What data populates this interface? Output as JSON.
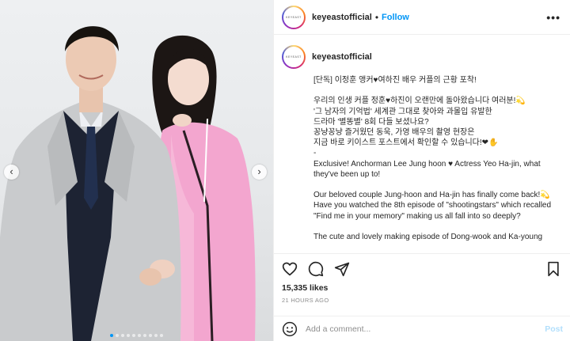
{
  "account": {
    "username": "keyeastofficial",
    "separator": "•",
    "follow_label": "Follow",
    "more_label": "•••",
    "logo_text": "KEYEAST"
  },
  "caption": {
    "lines": [
      "[단독] 이정훈 앵커♥여하진 배우 커플의 근황 포착!",
      "",
      "우리의 인생 커플 정훈♥하진이 오랜만에 돌아왔습니다 여러분!💫",
      "'그 남자의 기억법' 세계관 그대로 찾아와 과몰입 유발한",
      "드라마 '별똥별' 8회 다들 보셨나요?",
      "꽁냥꽁냥 즐거웠던 동욱, 가영 배우의 촬영 현장은",
      "지금 바로 키이스트 포스트에서 확인할 수 있습니다!❤✋",
      "-",
      "Exclusive! Anchorman Lee Jung hoon ♥ Actress Yeo Ha-jin, what",
      "they've been up to!",
      "",
      "Our beloved couple Jung-hoon and Ha-jin has finally come back!💫",
      "Have you watched the 8th episode of \"shootingstars\" which recalled",
      "\"Find me in your memory\" making us all fall into so deeply?",
      "",
      "The cute and lovely making episode of Dong-wook and Ka-young"
    ]
  },
  "post": {
    "likes": "15,335 likes",
    "time": "21 HOURS AGO"
  },
  "carousel": {
    "prev_label": "‹",
    "next_label": "›",
    "dot_count": 10,
    "active_dot": 0
  },
  "comment": {
    "placeholder": "Add a comment...",
    "post_label": "Post"
  },
  "icons": {
    "like": "heart-icon",
    "comment": "comment-bubble-icon",
    "share": "paper-plane-icon",
    "save": "bookmark-icon",
    "emoji": "smiley-icon"
  },
  "colors": {
    "accent": "#0095f6",
    "post_disabled": "#b2dffc",
    "muted": "#8e8e8e"
  }
}
